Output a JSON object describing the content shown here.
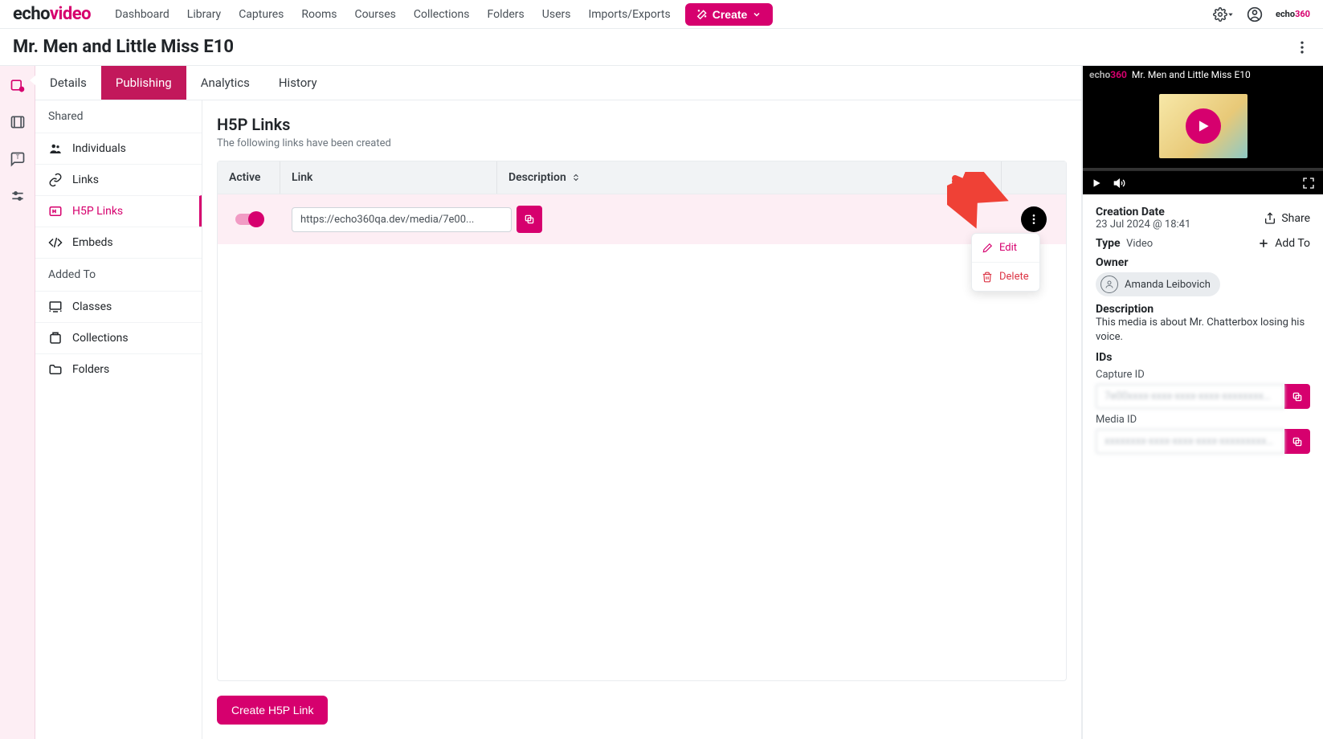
{
  "brand": {
    "echo": "echo",
    "video": "video"
  },
  "nav": {
    "items": [
      "Dashboard",
      "Library",
      "Captures",
      "Rooms",
      "Courses",
      "Collections",
      "Folders",
      "Users",
      "Imports/Exports"
    ],
    "create": "Create"
  },
  "page": {
    "title": "Mr. Men and Little Miss E10"
  },
  "tabs": [
    "Details",
    "Publishing",
    "Analytics",
    "History"
  ],
  "active_tab": 1,
  "sidebar": {
    "shared_title": "Shared",
    "shared_items": [
      {
        "label": "Individuals"
      },
      {
        "label": "Links"
      },
      {
        "label": "H5P Links"
      },
      {
        "label": "Embeds"
      }
    ],
    "added_title": "Added To",
    "added_items": [
      {
        "label": "Classes"
      },
      {
        "label": "Collections"
      },
      {
        "label": "Folders"
      }
    ],
    "active_shared": 2
  },
  "main": {
    "heading": "H5P Links",
    "sub": "The following links have been created",
    "columns": {
      "active": "Active",
      "link": "Link",
      "description": "Description"
    },
    "rows": [
      {
        "active": true,
        "link": "https://echo360qa.dev/media/7e00..."
      }
    ],
    "menu": {
      "edit": "Edit",
      "delete": "Delete"
    },
    "create_btn": "Create H5P Link"
  },
  "preview": {
    "title": "Mr. Men and Little Miss E10"
  },
  "meta": {
    "creation_label": "Creation Date",
    "creation_value": "23 Jul 2024 @ 18:41",
    "share": "Share",
    "type_label": "Type",
    "type_value": "Video",
    "add_to": "Add To",
    "owner_label": "Owner",
    "owner_name": "Amanda Leibovich",
    "desc_label": "Description",
    "desc_text": "This media is about Mr. Chatterbox losing his voice.",
    "ids_label": "IDs",
    "capture_id_label": "Capture ID",
    "capture_id_value": "7e00xxxx-xxxx-xxxx-xxxx-xxxxxxxxxx...",
    "media_id_label": "Media ID",
    "media_id_value": "xxxxxxxx-xxxx-xxxx-xxxx-xxxxxxxxxx..."
  }
}
